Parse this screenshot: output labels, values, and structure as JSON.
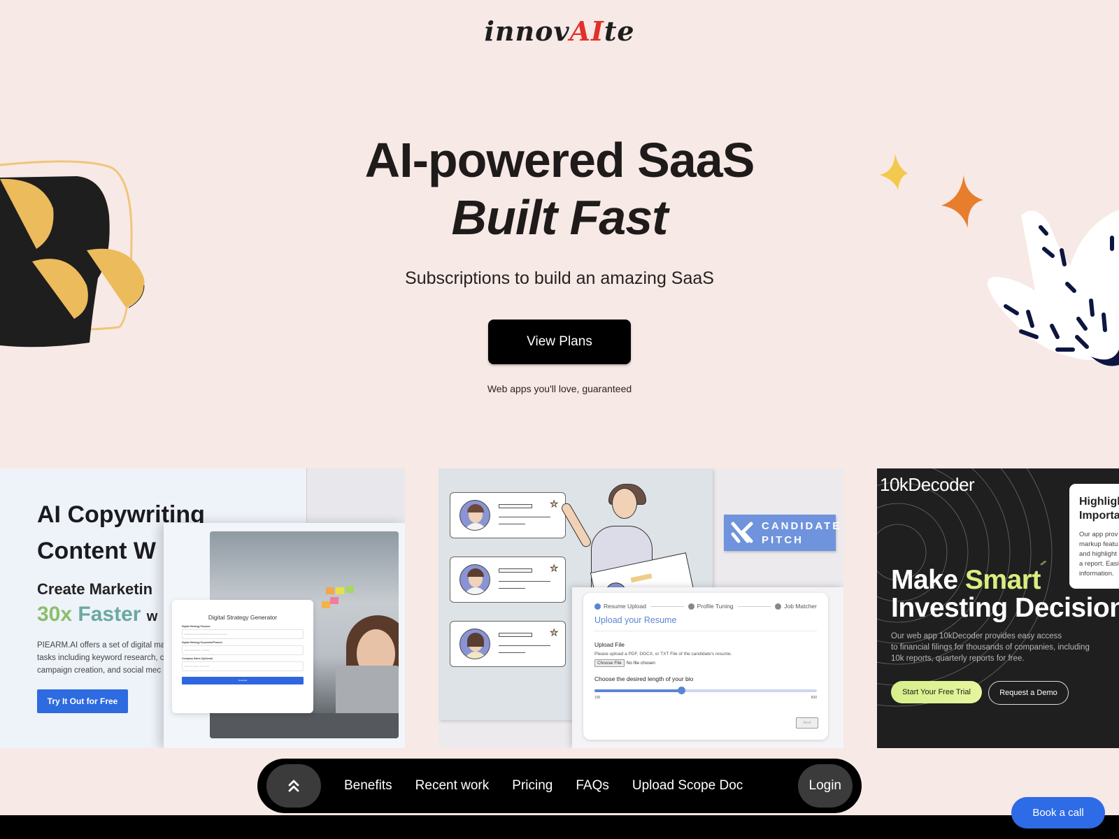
{
  "brand": {
    "logo_prefix": "innov",
    "logo_ai": "AI",
    "logo_suffix": "te",
    "accent_color": "#e2302a"
  },
  "hero": {
    "title_line1": "AI-powered SaaS",
    "title_line2": "Built Fast",
    "subtitle": "Subscriptions to build an amazing SaaS",
    "cta_label": "View Plans",
    "note": "Web apps you'll love, guaranteed"
  },
  "recent_work": [
    {
      "name": "PIEARM.AI",
      "heading_line1": "AI Copywriting",
      "heading_line2": "Content W",
      "subheading": "Create Marketin",
      "speed_a": "30x",
      "speed_b": "Faster",
      "speed_tail": "w",
      "description": "PIEARM.AI offers a set of digital ma tasks including keyword research, c campaign creation, and social mec",
      "button_label": "Try It Out for Free",
      "form": {
        "title": "Digital Strategy Generator",
        "fields": [
          {
            "label": "Digital Strategy Purpose",
            "placeholder": "Explaining a Financial Advisory firm's services"
          },
          {
            "label": "Digital Strategy Keywords/Phrases",
            "placeholder": "Financial advisor in Atlanta"
          },
          {
            "label": "Company Name (Optional)",
            "placeholder": "Enter company name here"
          }
        ],
        "button_label": "Generate"
      }
    },
    {
      "name": "Candidate Pitch",
      "logo_line1": "CANDIDATE",
      "logo_line2": "PITCH",
      "steps": [
        "Resume Upload",
        "Profile Tuning",
        "Job Matcher"
      ],
      "active_step": 0,
      "form_title": "Upload your Resume",
      "upload_label": "Upload File",
      "upload_help": "Please upload a PDF, DOCX, or TXT File of the candidate's resume.",
      "choose_file_label": "Choose File",
      "no_file_text": "No file chosen",
      "length_label": "Choose the desired length of your bio",
      "slider_min": "100",
      "slider_max": "600",
      "slider_value_fraction": 0.39,
      "next_label": "Next"
    },
    {
      "name": "10kDecoder",
      "highlight_title_line1": "Highligh",
      "highlight_title_line2": "Importa",
      "highlight_body": [
        "Our app prov",
        "markup featu",
        "and highlight",
        "a report. Easi",
        "information."
      ],
      "title_word1": "Make",
      "title_word2": "Smart",
      "title_line2": "Investing Decision",
      "description_lines": [
        "Our web app 10kDecoder provides easy access",
        "to financial filings for thousands of companies, including",
        "10k reports, quarterly reports for free."
      ],
      "primary_button": "Start Your Free Trial",
      "secondary_button": "Request a Demo",
      "accent_color": "#d8ef7f"
    }
  ],
  "nav": {
    "items": [
      "Benefits",
      "Recent work",
      "Pricing",
      "FAQs",
      "Upload Scope Doc"
    ],
    "login_label": "Login",
    "scroll_top_icon": "double-chevron-up-icon"
  },
  "floating": {
    "book_call_label": "Book a call",
    "color": "#2e6be6"
  }
}
